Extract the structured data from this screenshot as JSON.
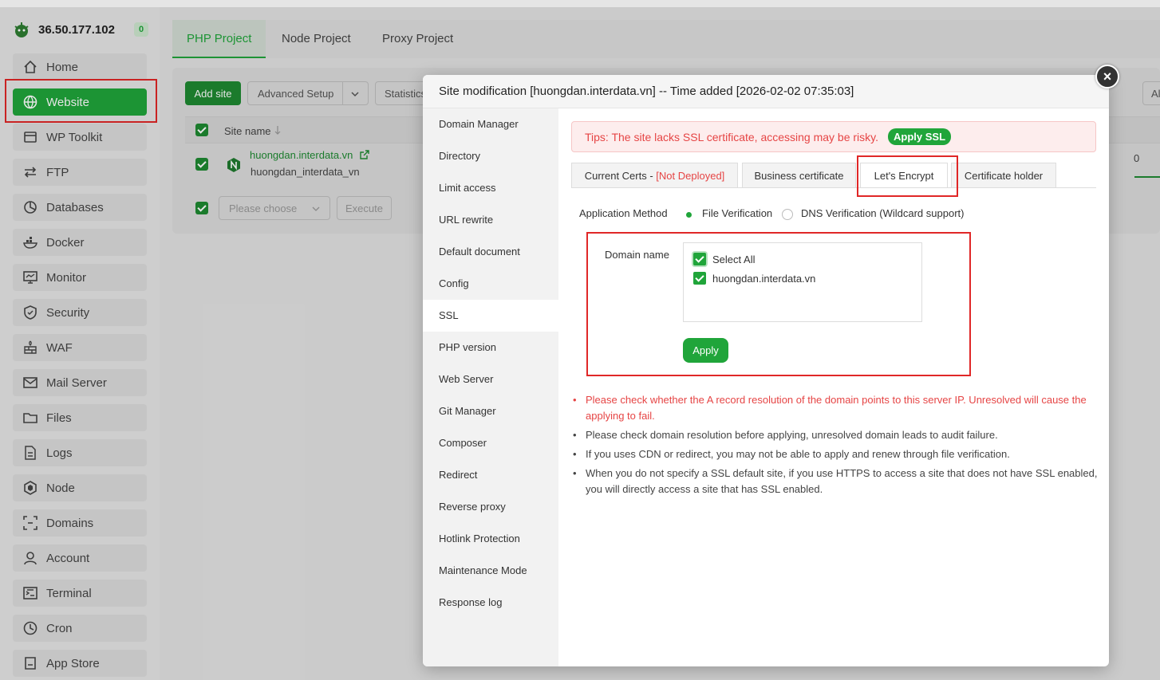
{
  "server": {
    "ip": "36.50.177.102",
    "badge": "0"
  },
  "sidebar": {
    "items": [
      {
        "label": "Home",
        "icon": "home-icon"
      },
      {
        "label": "Website",
        "icon": "globe-icon",
        "active": true
      },
      {
        "label": "WP Toolkit",
        "icon": "wp-toolkit-icon"
      },
      {
        "label": "FTP",
        "icon": "ftp-icon"
      },
      {
        "label": "Databases",
        "icon": "database-icon"
      },
      {
        "label": "Docker",
        "icon": "docker-icon"
      },
      {
        "label": "Monitor",
        "icon": "monitor-icon"
      },
      {
        "label": "Security",
        "icon": "shield-icon"
      },
      {
        "label": "WAF",
        "icon": "firewall-icon"
      },
      {
        "label": "Mail Server",
        "icon": "mail-icon"
      },
      {
        "label": "Files",
        "icon": "folder-icon"
      },
      {
        "label": "Logs",
        "icon": "log-file-icon"
      },
      {
        "label": "Node",
        "icon": "node-icon"
      },
      {
        "label": "Domains",
        "icon": "domains-icon"
      },
      {
        "label": "Account",
        "icon": "user-icon"
      },
      {
        "label": "Terminal",
        "icon": "terminal-icon"
      },
      {
        "label": "Cron",
        "icon": "clock-icon"
      },
      {
        "label": "App Store",
        "icon": "app-store-icon"
      }
    ]
  },
  "project_tabs": [
    "PHP Project",
    "Node Project",
    "Proxy Project"
  ],
  "toolbar": {
    "add_site": "Add site",
    "advanced_setup": "Advanced Setup",
    "statistics": "Statistics",
    "right_partial": "Al"
  },
  "table": {
    "header_site_name": "Site name",
    "row": {
      "domain": "huongdan.interdata.vn",
      "alias": "huongdan_interdata_vn",
      "right_value": "0"
    },
    "batch_placeholder": "Please choose",
    "execute": "Execute"
  },
  "modal": {
    "title": "Site modification [huongdan.interdata.vn] -- Time added [2026-02-02 07:35:03]",
    "close": "×",
    "menu": [
      "Domain Manager",
      "Directory",
      "Limit access",
      "URL rewrite",
      "Default document",
      "Config",
      "SSL",
      "PHP version",
      "Web Server",
      "Git Manager",
      "Composer",
      "Redirect",
      "Reverse proxy",
      "Hotlink Protection",
      "Maintenance Mode",
      "Response log"
    ],
    "active_menu": "SSL",
    "tips": {
      "text": "Tips: The site lacks SSL certificate, accessing may be risky.",
      "button": "Apply SSL"
    },
    "cert_tabs": {
      "current": "Current Certs - ",
      "current_status": "[Not Deployed]",
      "business": "Business certificate",
      "letsencrypt": "Let's Encrypt",
      "holder": "Certificate holder"
    },
    "application_method": {
      "label": "Application Method",
      "option_file": "File Verification",
      "option_dns": "DNS Verification (Wildcard support)",
      "selected": "File Verification"
    },
    "domain_name": {
      "label": "Domain name",
      "select_all": "Select All",
      "domains": [
        "huongdan.interdata.vn"
      ]
    },
    "apply_button": "Apply",
    "notes": [
      "Please check whether the A record resolution of the domain points to this server IP. Unresolved will cause the applying to fail.",
      "Please check domain resolution before applying, unresolved domain leads to audit failure.",
      "If you uses CDN or redirect, you may not be able to apply and renew through file verification.",
      "When you do not specify a SSL default site, if you use HTTPS to access a site that does not have SSL enabled, you will directly access a site that has SSL enabled."
    ]
  },
  "colors": {
    "accent": "#20a53a",
    "danger": "#e64545",
    "highlight_box": "#e02727"
  }
}
